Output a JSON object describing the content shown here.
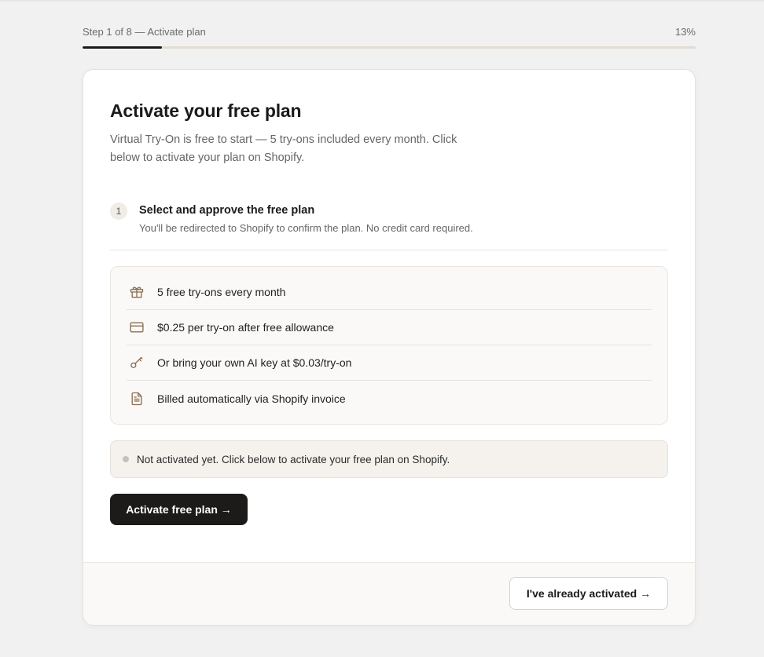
{
  "progress": {
    "label": "Step 1 of 8 — Activate plan",
    "percent_label": "13%",
    "fraction": 0.13
  },
  "card": {
    "title": "Activate your free plan",
    "subtitle": "Virtual Try-On is free to start — 5 try-ons included every month. Click below to activate your plan on Shopify.",
    "step": {
      "number": "1",
      "title": "Select and approve the free plan",
      "description": "You'll be redirected to Shopify to confirm the plan. No credit card required."
    },
    "features": [
      {
        "icon": "gift-icon",
        "text": "5 free try-ons every month"
      },
      {
        "icon": "credit-card-icon",
        "text": "$0.25 per try-on after free allowance"
      },
      {
        "icon": "key-icon",
        "text": "Or bring your own AI key at $0.03/try-on"
      },
      {
        "icon": "document-icon",
        "text": "Billed automatically via Shopify invoice"
      }
    ],
    "status": {
      "text": "Not activated yet. Click below to activate your free plan on Shopify."
    },
    "primary_button": "Activate free plan →",
    "secondary_button": "I've already activated →"
  },
  "colors": {
    "accent_dark": "#1c1b19",
    "icon_brown": "#8a6d4f",
    "progress_track": "#e3dcd3"
  }
}
